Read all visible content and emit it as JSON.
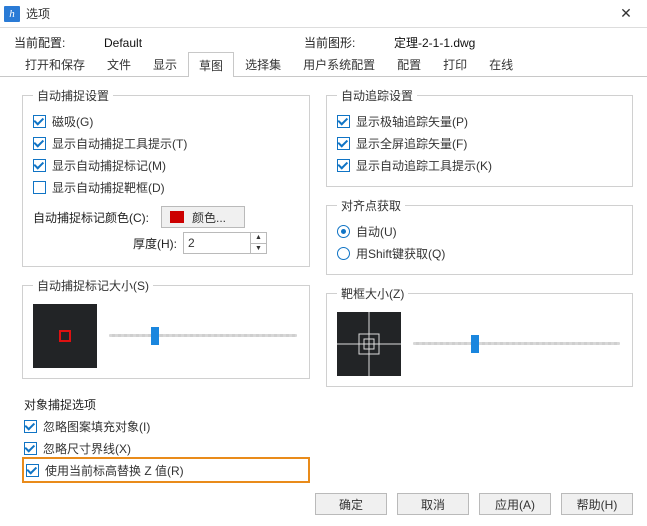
{
  "window": {
    "title": "选项",
    "close_glyph": "✕"
  },
  "header": {
    "current_profile_label": "当前配置:",
    "current_profile_value": "Default",
    "current_drawing_label": "当前图形:",
    "current_drawing_value": "定理-2-1-1.dwg"
  },
  "tabs": [
    "打开和保存",
    "文件",
    "显示",
    "草图",
    "选择集",
    "用户系统配置",
    "配置",
    "打印",
    "在线"
  ],
  "active_tab": "草图",
  "autosnap": {
    "legend": "自动捕捉设置",
    "checks": [
      {
        "label": "磁吸(G)",
        "checked": true
      },
      {
        "label": "显示自动捕捉工具提示(T)",
        "checked": true
      },
      {
        "label": "显示自动捕捉标记(M)",
        "checked": true
      },
      {
        "label": "显示自动捕捉靶框(D)",
        "checked": false
      }
    ],
    "color_label": "自动捕捉标记颜色(C):",
    "color_button": "颜色...",
    "thickness_label": "厚度(H):",
    "thickness_value": "2"
  },
  "autotrack": {
    "legend": "自动追踪设置",
    "checks": [
      {
        "label": "显示极轴追踪矢量(P)",
        "checked": true
      },
      {
        "label": "显示全屏追踪矢量(F)",
        "checked": true
      },
      {
        "label": "显示自动追踪工具提示(K)",
        "checked": true
      }
    ]
  },
  "alignment": {
    "legend": "对齐点获取",
    "radios": [
      {
        "label": "自动(U)",
        "checked": true
      },
      {
        "label": "用Shift键获取(Q)",
        "checked": false
      }
    ]
  },
  "marker_size": {
    "legend": "自动捕捉标记大小(S)"
  },
  "aperture_size": {
    "legend": "靶框大小(Z)"
  },
  "object_snap": {
    "title": "对象捕捉选项",
    "checks": [
      {
        "label": "忽略图案填充对象(I)",
        "checked": true
      },
      {
        "label": "忽略尺寸界线(X)",
        "checked": true
      },
      {
        "label": "使用当前标高替换 Z 值(R)",
        "checked": true
      }
    ]
  },
  "footer": {
    "ok": "确定",
    "cancel": "取消",
    "apply": "应用(A)",
    "help": "帮助(H)"
  }
}
